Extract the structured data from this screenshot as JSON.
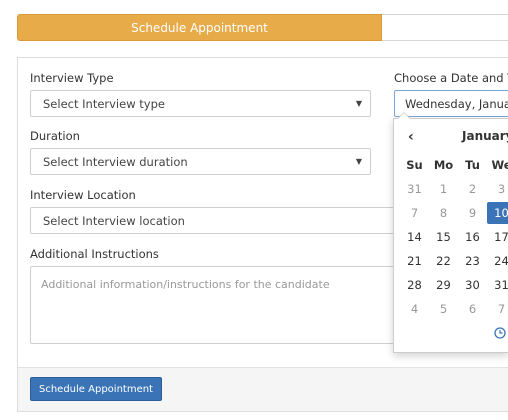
{
  "tabs": {
    "active_label": "Schedule Appointment"
  },
  "form": {
    "interview_type": {
      "label": "Interview Type",
      "value": "Select Interview type"
    },
    "duration": {
      "label": "Duration",
      "value": "Select Interview duration"
    },
    "location": {
      "label": "Interview Location",
      "value": "Select Interview location"
    },
    "instructions": {
      "label": "Additional Instructions",
      "placeholder": "Additional information/instructions for the candidate"
    },
    "date": {
      "label": "Choose a Date and Tim",
      "value": "Wednesday, January"
    }
  },
  "calendar": {
    "month": "January",
    "prev_icon": "‹",
    "weekdays": [
      "Su",
      "Mo",
      "Tu",
      "We"
    ],
    "weeks": [
      [
        {
          "d": "31",
          "t": "old"
        },
        {
          "d": "1",
          "t": "old"
        },
        {
          "d": "2",
          "t": "old"
        },
        {
          "d": "3",
          "t": "old"
        }
      ],
      [
        {
          "d": "7",
          "t": "old"
        },
        {
          "d": "8",
          "t": "old"
        },
        {
          "d": "9",
          "t": "old"
        },
        {
          "d": "10",
          "t": "sel"
        }
      ],
      [
        {
          "d": "14",
          "t": "cur"
        },
        {
          "d": "15",
          "t": "cur"
        },
        {
          "d": "16",
          "t": "cur"
        },
        {
          "d": "17",
          "t": "cur"
        }
      ],
      [
        {
          "d": "21",
          "t": "cur"
        },
        {
          "d": "22",
          "t": "cur"
        },
        {
          "d": "23",
          "t": "cur"
        },
        {
          "d": "24",
          "t": "cur"
        }
      ],
      [
        {
          "d": "28",
          "t": "cur"
        },
        {
          "d": "29",
          "t": "cur"
        },
        {
          "d": "30",
          "t": "cur"
        },
        {
          "d": "31",
          "t": "cur"
        }
      ],
      [
        {
          "d": "4",
          "t": "old"
        },
        {
          "d": "5",
          "t": "old"
        },
        {
          "d": "6",
          "t": "old"
        },
        {
          "d": "7",
          "t": "old"
        }
      ]
    ]
  },
  "footer": {
    "submit_label": "Schedule Appointment"
  },
  "colors": {
    "accent": "#e8ab4a",
    "primary": "#3a74b6"
  }
}
